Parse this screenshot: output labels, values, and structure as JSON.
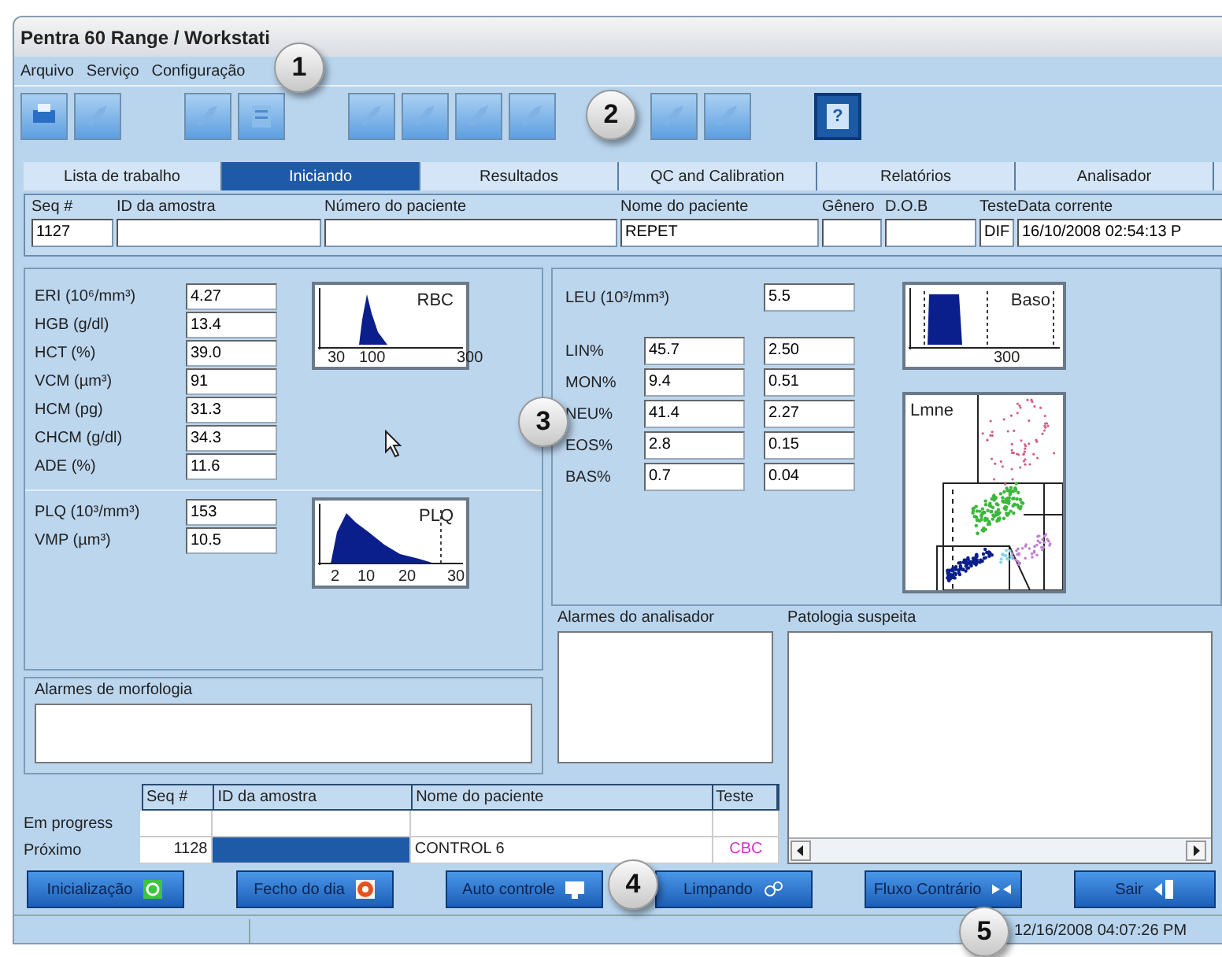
{
  "window": {
    "title": "Pentra 60 Range / Workstati"
  },
  "menu": [
    "Arquivo",
    "Serviço",
    "Configuração"
  ],
  "toolbar_groups": [
    {
      "buttons": [
        {
          "kind": "printer"
        },
        {
          "kind": "tool"
        }
      ]
    },
    {
      "buttons": [
        {
          "kind": "tool"
        },
        {
          "kind": "list"
        }
      ]
    },
    {
      "buttons": [
        {
          "kind": "tool"
        },
        {
          "kind": "tool"
        },
        {
          "kind": "tool"
        },
        {
          "kind": "tool"
        }
      ]
    },
    {
      "buttons": [
        {
          "kind": "tool"
        },
        {
          "kind": "tool"
        }
      ]
    },
    {
      "buttons": [
        {
          "kind": "help",
          "label": "?"
        }
      ]
    }
  ],
  "tabs": [
    {
      "label": "Lista de trabalho",
      "selected": false
    },
    {
      "label": "Iniciando",
      "selected": true
    },
    {
      "label": "Resultados",
      "selected": false
    },
    {
      "label": "QC and Calibration",
      "selected": false
    },
    {
      "label": "Relatórios",
      "selected": false
    },
    {
      "label": "Analisador",
      "selected": false
    }
  ],
  "sample_fields": [
    {
      "label": "Seq #",
      "value": "1127"
    },
    {
      "label": "ID da amostra"
    },
    {
      "label": "Número do paciente"
    },
    {
      "label": "Nome do paciente",
      "value": "REPET"
    },
    {
      "label": "Gênero"
    },
    {
      "label": "D.O.B"
    },
    {
      "label": "Teste",
      "value": "DIF"
    },
    {
      "label": "Data corrente",
      "value": "16/10/2008 02:54:13 P"
    }
  ],
  "rbc_params": [
    {
      "label": "ERI (10⁶/mm³)",
      "value": "4.27"
    },
    {
      "label": "HGB (g/dl)",
      "value": "13.4"
    },
    {
      "label": "HCT (%)",
      "value": "39.0"
    },
    {
      "label": "VCM (µm³)",
      "value": "91"
    },
    {
      "label": "HCM (pg)",
      "value": "31.3"
    },
    {
      "label": "CHCM (g/dl)",
      "value": "34.3"
    },
    {
      "label": "ADE (%)",
      "value": "11.6"
    }
  ],
  "rbc_histogram": {
    "title": "RBC",
    "ticks": [
      "30",
      "100",
      "300"
    ]
  },
  "plt_params": [
    {
      "label": "PLQ (10³/mm³)",
      "value": "153"
    },
    {
      "label": "VMP (µm³)",
      "value": "10.5"
    }
  ],
  "plt_histogram": {
    "title": "PLQ",
    "ticks": [
      "2",
      "10",
      "20",
      "30"
    ]
  },
  "leu": {
    "label": "LEU (10³/mm³)",
    "value": "5.5"
  },
  "diff": [
    {
      "label": "LIN%",
      "percent": "45.7",
      "absolute": "2.50"
    },
    {
      "label": "MON%",
      "percent": "9.4",
      "absolute": "0.51"
    },
    {
      "label": "NEU%",
      "percent": "41.4",
      "absolute": "2.27"
    },
    {
      "label": "EOS%",
      "percent": "2.8",
      "absolute": "0.15"
    },
    {
      "label": "BAS%",
      "percent": "0.7",
      "absolute": "0.04"
    }
  ],
  "baso_histogram": {
    "title": "Baso",
    "ticks": [
      "300"
    ]
  },
  "lmne_matrix": {
    "title": "Lmne"
  },
  "morphology_alarms": {
    "label": "Alarmes de morfologia"
  },
  "analyzer_alarms": {
    "label": "Alarmes do analisador"
  },
  "suspected_pathology": {
    "label": "Patologia suspeita"
  },
  "queue": {
    "columns": [
      "Seq #",
      "ID da amostra",
      "Nome do paciente",
      "Teste"
    ],
    "rows": [
      {
        "label": "Em progress",
        "selected": false
      },
      {
        "label": "Próximo",
        "seq": "1128",
        "name": "CONTROL 6",
        "test": "CBC",
        "selected": true
      }
    ]
  },
  "actions": [
    {
      "label": "Inicialização",
      "kind": "power"
    },
    {
      "label": "Fecho do dia",
      "kind": "stop"
    },
    {
      "label": "Auto controle",
      "kind": "monitor"
    },
    {
      "label": "Limpando",
      "kind": "bubbles"
    },
    {
      "label": "Fluxo Contrário",
      "kind": "arrows"
    },
    {
      "label": "Sair",
      "kind": "exit"
    }
  ],
  "status_bar": {
    "datetime": "12/16/2008 04:07:26 PM"
  },
  "callouts": [
    "1",
    "2",
    "3",
    "4",
    "5"
  ]
}
